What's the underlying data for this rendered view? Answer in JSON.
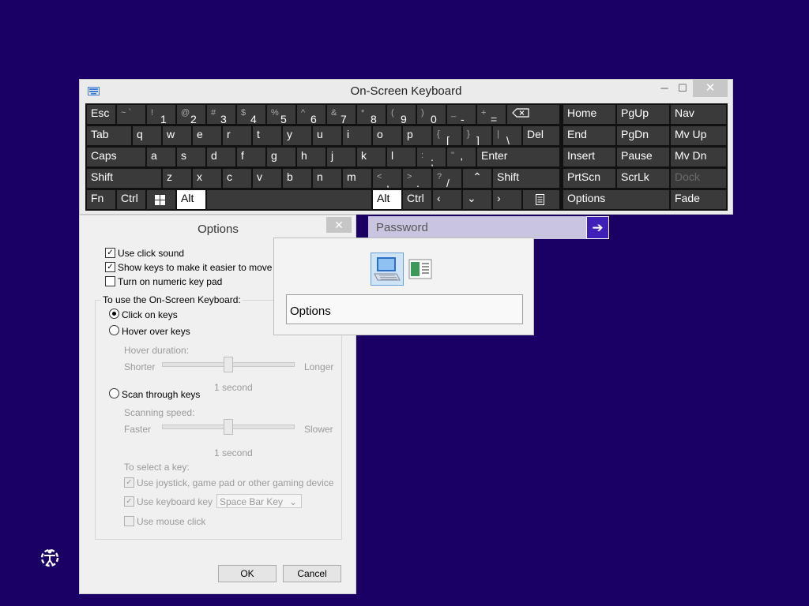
{
  "background_color": "#1a0064",
  "osk": {
    "title": "On-Screen Keyboard",
    "minimize": "─",
    "maximize": "☐",
    "close": "✕",
    "keys": {
      "esc": "Esc",
      "tilde_shift": "~ `",
      "d1s": "!",
      "d1": "1",
      "d2s": "@",
      "d2": "2",
      "d3s": "#",
      "d3": "3",
      "d4s": "$",
      "d4": "4",
      "d5s": "%",
      "d5": "5",
      "d6s": "^",
      "d6": "6",
      "d7s": "&",
      "d7": "7",
      "d8s": "*",
      "d8": "8",
      "d9s": "(",
      "d9": "9",
      "d0s": ")",
      "d0": "0",
      "minus_s": "_",
      "minus": "-",
      "plus_s": "+",
      "equals": "=",
      "tab": "Tab",
      "q": "q",
      "w": "w",
      "e": "e",
      "r": "r",
      "t": "t",
      "y": "y",
      "u": "u",
      "i": "i",
      "o": "o",
      "p": "p",
      "lbrace_s": "{",
      "lbrace": "[",
      "rbrace_s": "}",
      "rbrace": "]",
      "pipe_s": "|",
      "backslash": "\\",
      "del": "Del",
      "caps": "Caps",
      "a": "a",
      "s": "s",
      "d": "d",
      "f": "f",
      "g": "g",
      "h": "h",
      "j": "j",
      "k": "k",
      "l": "l",
      "colon_s": ":",
      "semicolon": ";",
      "quote_s": "\"",
      "quote": "'",
      "enter": "Enter",
      "shift": "Shift",
      "z": "z",
      "x": "x",
      "c": "c",
      "v": "v",
      "b": "b",
      "n": "n",
      "m": "m",
      "lt_s": "<",
      "comma": ",",
      "gt_s": ">",
      "period": ".",
      "qmark_s": "?",
      "slash": "/",
      "up": "⌃",
      "shift_r": "Shift",
      "fn": "Fn",
      "ctrl": "Ctrl",
      "alt": "Alt",
      "alt_r": "Alt",
      "ctrl_r": "Ctrl",
      "left": "‹",
      "down": "⌄",
      "right": "›",
      "home": "Home",
      "pgup": "PgUp",
      "nav": "Nav",
      "end": "End",
      "pgdn": "PgDn",
      "mvup": "Mv Up",
      "insert": "Insert",
      "pause": "Pause",
      "mvdn": "Mv Dn",
      "prtscn": "PrtScn",
      "scrlk": "ScrLk",
      "dock": "Dock",
      "options": "Options",
      "fade": "Fade"
    }
  },
  "options": {
    "title": "Options",
    "close": "✕",
    "use_click_sound": "Use click sound",
    "show_keys": "Show keys to make it easier to move arour",
    "numeric_pad": "Turn on numeric key pad",
    "group_label": "To use the On-Screen Keyboard:",
    "click_on_keys": "Click on keys",
    "hover_over_keys": "Hover over keys",
    "hover_duration": "Hover duration:",
    "shorter": "Shorter",
    "longer": "Longer",
    "hover_value": "1 second",
    "hover_level": 0.5,
    "scan_through_keys": "Scan through keys",
    "scanning_speed": "Scanning speed:",
    "faster": "Faster",
    "slower": "Slower",
    "scan_value": "1 second",
    "scan_level": 0.5,
    "to_select_key": "To select a key:",
    "use_joystick": "Use joystick, game pad or other gaming device",
    "use_keyboard_key": "Use keyboard key",
    "keyboard_key_value": "Space Bar Key",
    "use_mouse_click": "Use mouse click",
    "ok": "OK",
    "cancel": "Cancel"
  },
  "password": {
    "placeholder": "Password",
    "submit_arrow": "➔"
  },
  "popup": {
    "option_label": "Options"
  }
}
